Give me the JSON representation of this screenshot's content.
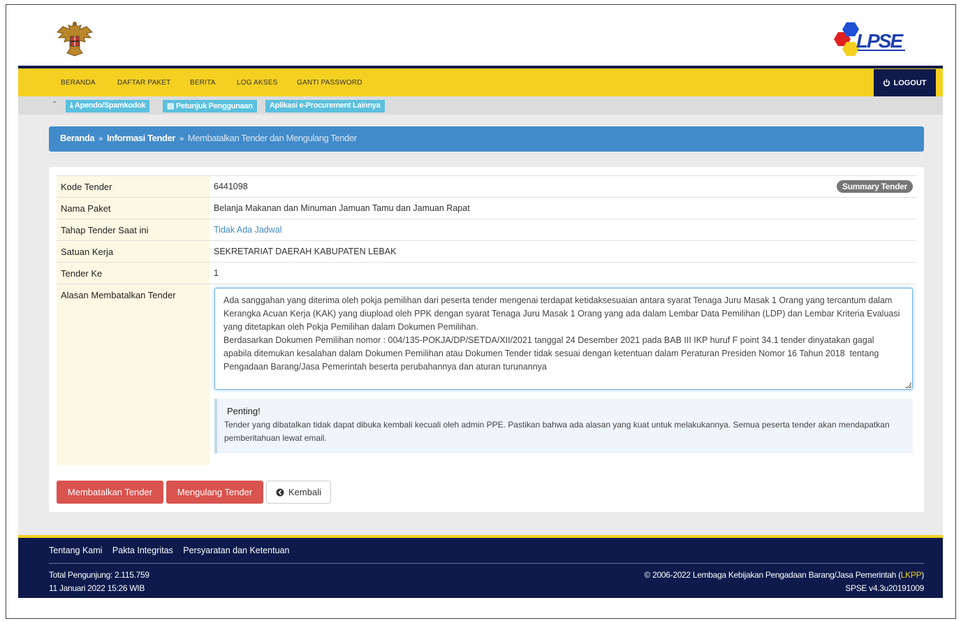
{
  "nav": {
    "items": [
      "BERANDA",
      "DAFTAR PAKET",
      "BERITA",
      "LOG AKSES",
      "GANTI PASSWORD"
    ],
    "logout": "LOGOUT"
  },
  "subbar": {
    "buttons": [
      "Apendo/Spamkodok",
      "Petunjuk Penggunaan",
      "Aplikasi e-Procurement Lainnya"
    ]
  },
  "breadcrumb": {
    "home": "Beranda",
    "info": "Informasi Tender",
    "current": "Membatalkan Tender dan Mengulang Tender",
    "separator": "»"
  },
  "details": {
    "kode_label": "Kode Tender",
    "kode_value": "6441098",
    "summary_badge": "Summary Tender",
    "nama_label": "Nama Paket",
    "nama_value": "Belanja Makanan dan Minuman Jamuan Tamu dan Jamuan Rapat",
    "tahap_label": "Tahap Tender Saat ini",
    "tahap_value": "Tidak Ada Jadwal",
    "satuan_label": "Satuan Kerja",
    "satuan_value": "SEKRETARIAT DAERAH KABUPATEN LEBAK",
    "ke_label": "Tender Ke",
    "ke_value": "1",
    "alasan_label": "Alasan Membatalkan Tender"
  },
  "alasan_text": "Ada sanggahan yang diterima oleh pokja pemilihan dari peserta tender mengenai terdapat ketidaksesuaian antara syarat Tenaga Juru Masak 1 Orang yang tercantum dalam Kerangka Acuan Kerja (KAK) yang diupload oleh PPK dengan syarat Tenaga Juru Masak 1 Orang yang ada dalam Lembar Data Pemilihan (LDP) dan Lembar Kriteria Evaluasi yang ditetapkan oleh Pokja Pemilihan dalam Dokumen Pemilihan.\nBerdasarkan Dokumen Pemilihan nomor : 004/135-POKJA/DP/SETDA/XII/2021 tanggal 24 Desember 2021 pada BAB III IKP huruf F point 34.1 tender dinyatakan gagal apabila ditemukan kesalahan dalam Dokumen Pemilihan atau Dokumen Tender tidak sesuai dengan ketentuan dalam Peraturan Presiden Nomor 16 Tahun 2018  tentang Pengadaan Barang/Jasa Pemerintah beserta perubahannya dan aturan turunannya",
  "alert": {
    "title": "Penting!",
    "text": "Tender yang dibatalkan tidak dapat dibuka kembali kecuali oleh admin PPE. Pastikan bahwa ada alasan yang kuat untuk melakukannya. Semua peserta tender akan mendapatkan pemberitahuan lewat email."
  },
  "buttons": {
    "batal": "Membatalkan Tender",
    "ulang": "Mengulang Tender",
    "kembali": "Kembali"
  },
  "footer": {
    "links": [
      "Tentang Kami",
      "Pakta Integritas",
      "Persyaratan dan Ketentuan"
    ],
    "visitors": "Total Pengunjung: 2.115.759",
    "datetime": "11 Januari 2022 15:26 WIB",
    "copyright_prefix": "© 2006-2022 Lembaga Kebijakan Pengadaan Barang/Jasa Pemerintah (",
    "copyright_link": "LKPP",
    "copyright_suffix": ")",
    "version": "SPSE v4.3u20191009"
  },
  "icons": {
    "garuda": "garuda-emblem",
    "lpse": "lpse-logo",
    "logout": "power-icon",
    "download": "download-icon",
    "book": "book-icon",
    "back": "arrow-left-circle-icon",
    "caret": "chevron-up-icon"
  },
  "colors": {
    "navbar": "#f5d020",
    "navy": "#0d1a4b",
    "breadcrumb": "#428bca",
    "label_bg": "#fcf8e3",
    "danger": "#d9534f",
    "info_btn": "#5bc0de"
  }
}
